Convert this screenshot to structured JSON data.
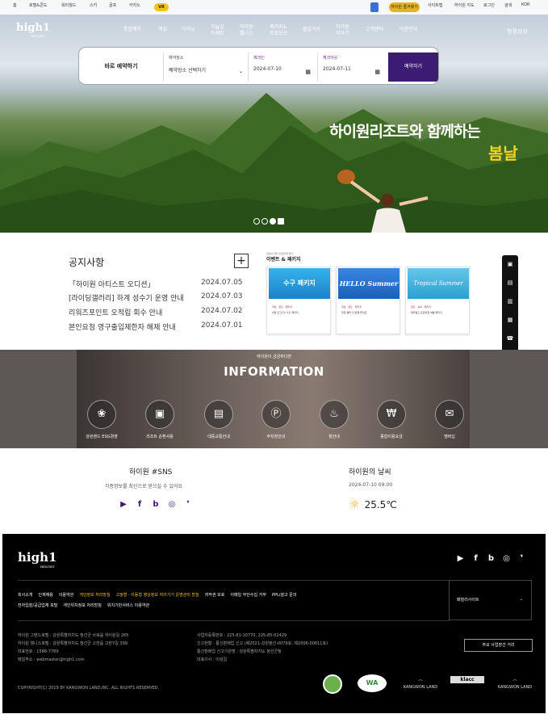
{
  "topbar": {
    "left_links": [
      "홈",
      "호텔&콘도",
      "워터월드",
      "스키",
      "골프",
      "카지노"
    ],
    "vr_badge": "VR",
    "favorite_label": "하이원 즐겨찾기",
    "right_links": [
      "사이트맵",
      "하이원 지도",
      "로그인",
      "검색",
      "KOR"
    ]
  },
  "logo": {
    "name": "high1",
    "sub": "RESORT"
  },
  "nav": {
    "items": [
      {
        "label": "통합예약"
      },
      {
        "label": "객실"
      },
      {
        "label": "다이닝"
      },
      {
        "label": "하늘길\n트레킹"
      },
      {
        "label": "하이원\n웰니스"
      },
      {
        "label": "패키지&\n프로모션"
      },
      {
        "label": "즐길거리"
      },
      {
        "label": "하이원\n이야기"
      },
      {
        "label": "고객센터"
      },
      {
        "label": "이용안내"
      }
    ],
    "motto": "청정상상"
  },
  "booking": {
    "title": "바로 예약하기",
    "place_label": "예약장소",
    "place_value": "예약장소 선택하기",
    "checkin_label": "체크인",
    "checkin_value": "2024-07-10",
    "checkout_label": "체크아웃",
    "checkout_value": "2024-07-11",
    "submit": "예약하기"
  },
  "hero": {
    "slogan_line1": "하이원리조트와 함께하는",
    "slogan_line2": "봄날",
    "slide_count": 4
  },
  "notice": {
    "title": "공지사항",
    "plus": "+",
    "items": [
      {
        "title": "「하이원 아티스트 오디션」",
        "date": "2024.07.05"
      },
      {
        "title": "[라이딩갤러리] 하계 성수기 운영 안내",
        "date": "2024.07.03"
      },
      {
        "title": "리워즈포인트 오적립 회수 안내",
        "date": "2024.07.02"
      },
      {
        "title": "본인요청 영구출입제한자 해제 안내",
        "date": "2024.07.01"
      }
    ]
  },
  "events": {
    "caption": "정상의 재미 한정판매 특가",
    "title": "이벤트 & 패키지",
    "cards": [
      {
        "banner": "수구 패키지",
        "tag": "객실 · 골프 · 패키지",
        "text": "이달 또 오자! 수구 패키지",
        "color": "#2aa3e0"
      },
      {
        "banner": "HELLO Summer",
        "tag": "객실 · 골프 · 패키지",
        "text": "헬로 썸머 다 함께 즐겨요",
        "color": "#2d73d2"
      },
      {
        "banner": "Tropical Summer",
        "tag": "골프 · 숙박 · 패키지",
        "text": "워터월드 트로피컬 여름 패키지",
        "color": "#55b7de"
      }
    ]
  },
  "quick_menu": [
    "▣",
    "▤",
    "▥",
    "▦",
    "☎",
    "ⓘ",
    "◉",
    "▢"
  ],
  "info": {
    "subtitle": "하이원이 궁금하다면",
    "title": "INFORMATION",
    "items": [
      {
        "icon": "❀",
        "label": "강원랜드 ESG경영"
      },
      {
        "icon": "▣",
        "label": "리조트 순환셔틀"
      },
      {
        "icon": "▤",
        "label": "대중교통안내"
      },
      {
        "icon": "Ⓟ",
        "label": "주차장안내"
      },
      {
        "icon": "♨",
        "label": "힐안내"
      },
      {
        "icon": "₩",
        "label": "종합이용요금"
      },
      {
        "icon": "✉",
        "label": "멤버십"
      }
    ]
  },
  "sns": {
    "title": "하이원 #SNS",
    "desc": "각종정보를 최신으로 받으실 수 있어요",
    "icons": [
      "▶",
      "f",
      "b",
      "◎",
      "❜"
    ]
  },
  "weather": {
    "title": "하이원의 날씨",
    "time": "2024-07-10 09:00",
    "icon": "☼",
    "temp": "25.5℃"
  },
  "footer": {
    "logo": "high1",
    "logo_sub": "RESORT",
    "social": [
      "▶",
      "f",
      "b",
      "◎",
      "❜"
    ],
    "links": [
      {
        "label": "회사소개",
        "hl": false
      },
      {
        "label": "인재채용",
        "hl": false
      },
      {
        "label": "이용약관",
        "hl": false
      },
      {
        "label": "개인정보 처리방침",
        "hl": true
      },
      {
        "label": "고정형 · 이동형 영상정보 처리기기 운영관리 방침",
        "hl": true
      },
      {
        "label": "저작권 보호",
        "hl": false
      },
      {
        "label": "이메일 무단수집 거부",
        "hl": false
      },
      {
        "label": "PPL/광고 문의",
        "hl": false
      },
      {
        "label": "전자입찰/공급업체 포털",
        "hl": false
      },
      {
        "label": "개인위치정보 처리방침",
        "hl": false
      },
      {
        "label": "위치기반서비스 이용약관",
        "hl": false
      }
    ],
    "family_site": "패밀리사이트",
    "address_left": [
      "하이원 그랜드호텔 : 강원특별자치도 정선군 사북읍 하이원길 265",
      "하이원 웰니스호텔 : 강원특별자치도 정선군 고한읍 고한7길 399",
      "대표번호 : 1588-7789",
      "메일주소 : webmaster@high1.com"
    ],
    "address_right": [
      "사업자등록번호 : 225-81-10770, 225-85-02429",
      "신고현황 : 통신판매업 신고 (제2021-강원정선-0079호, 제2006-00011호)",
      "통신판매업 신고기관명 : 강원특별자치도 정선군청",
      "대표이사 : 이삼걸"
    ],
    "ethics": "주요 사업장간 거리",
    "copyright": "COPYRIGHT(C) 2019 BY KANGWON LAND,INC. ALL RIGHTS RESERVED.",
    "certs": [
      "",
      "WA",
      "KANGWON LAND",
      "klacc",
      "KANGWON LAND"
    ]
  }
}
